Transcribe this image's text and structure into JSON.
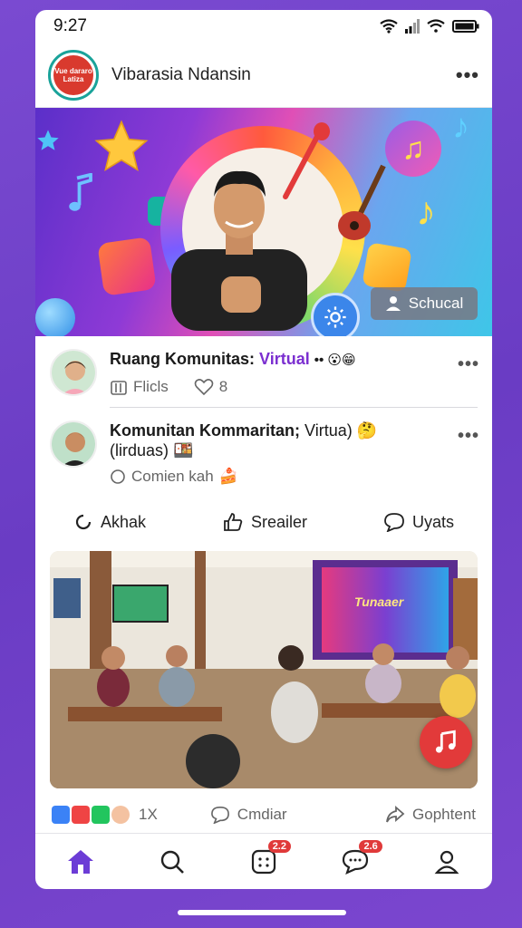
{
  "status": {
    "time": "9:27"
  },
  "header": {
    "title": "Vibarasia Ndansin",
    "logo_text": "Vue dararo Latiza"
  },
  "hero": {
    "schedule_label": "Schucal"
  },
  "posts": [
    {
      "title_bold": "Ruang Komunitas:",
      "title_accent": "Virtual",
      "meta1": "Flicls",
      "meta2": "8"
    },
    {
      "title_bold": "Komunitan Kommaritan;",
      "title_plain": "Virtua)",
      "subtitle": "(lirduas)",
      "comment_label": "Comien kah"
    }
  ],
  "actions": {
    "a1": "Akhak",
    "a2": "Sreailer",
    "a3": "Uyats"
  },
  "photo": {
    "sign_text": "Tunaaer"
  },
  "reactions": {
    "count": "1X",
    "comment": "Cmdiar",
    "share": "Gophtent"
  },
  "tabbar": {
    "badge_feed": "2.2",
    "badge_chat": "2.6"
  },
  "colors": {
    "accent": "#7b2fd0",
    "brand_bg": "#6a3cc4",
    "badge": "#e03a3a"
  }
}
